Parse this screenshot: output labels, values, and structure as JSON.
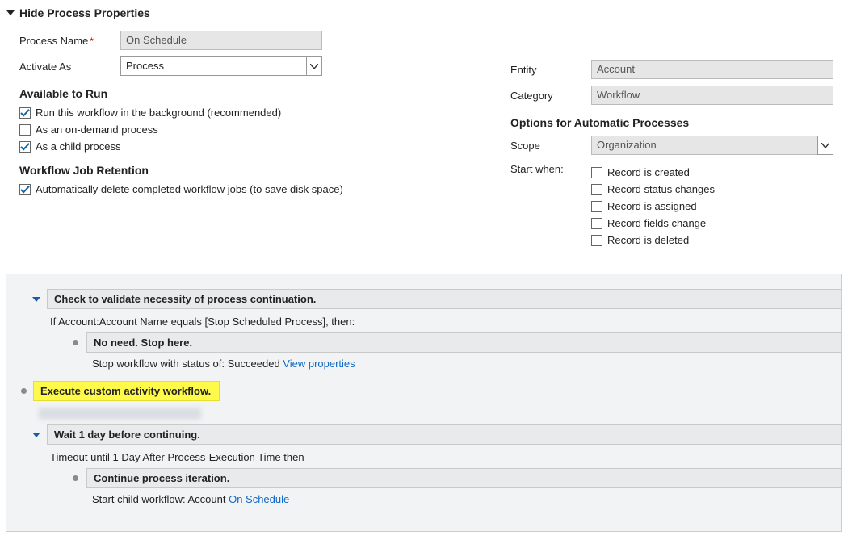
{
  "header_toggle": "Hide Process Properties",
  "left": {
    "process_name_label": "Process Name",
    "process_name_value": "On Schedule",
    "activate_as_label": "Activate As",
    "activate_as_value": "Process",
    "avail_head": "Available to Run",
    "chk_bg": "Run this workflow in the background (recommended)",
    "chk_ondemand": "As an on-demand process",
    "chk_child": "As a child process",
    "retention_head": "Workflow Job Retention",
    "chk_autodel": "Automatically delete completed workflow jobs (to save disk space)"
  },
  "right": {
    "entity_label": "Entity",
    "entity_value": "Account",
    "category_label": "Category",
    "category_value": "Workflow",
    "opts_head": "Options for Automatic Processes",
    "scope_label": "Scope",
    "scope_value": "Organization",
    "start_when_label": "Start when:",
    "sw_created": "Record is created",
    "sw_status": "Record status changes",
    "sw_assigned": "Record is assigned",
    "sw_fields": "Record fields change",
    "sw_deleted": "Record is deleted"
  },
  "steps": {
    "s1_title": "Check to validate necessity of process continuation.",
    "s1_cond": "If Account:Account Name equals [Stop Scheduled Process], then:",
    "s1_sub_title": "No need. Stop here.",
    "s1_sub_detail_prefix": "Stop workflow with status of:  Succeeded  ",
    "s1_sub_link": "View properties",
    "s2_title": "Execute custom activity workflow.",
    "s2_blur": "redactedtext redactedtext redacted",
    "s3_title": "Wait 1 day before continuing.",
    "s3_cond": "Timeout until 1 Day After Process-Execution Time then",
    "s3_sub_title": "Continue process iteration.",
    "s3_sub_detail_prefix": "Start child workflow:  Account  ",
    "s3_sub_link": "On Schedule"
  }
}
